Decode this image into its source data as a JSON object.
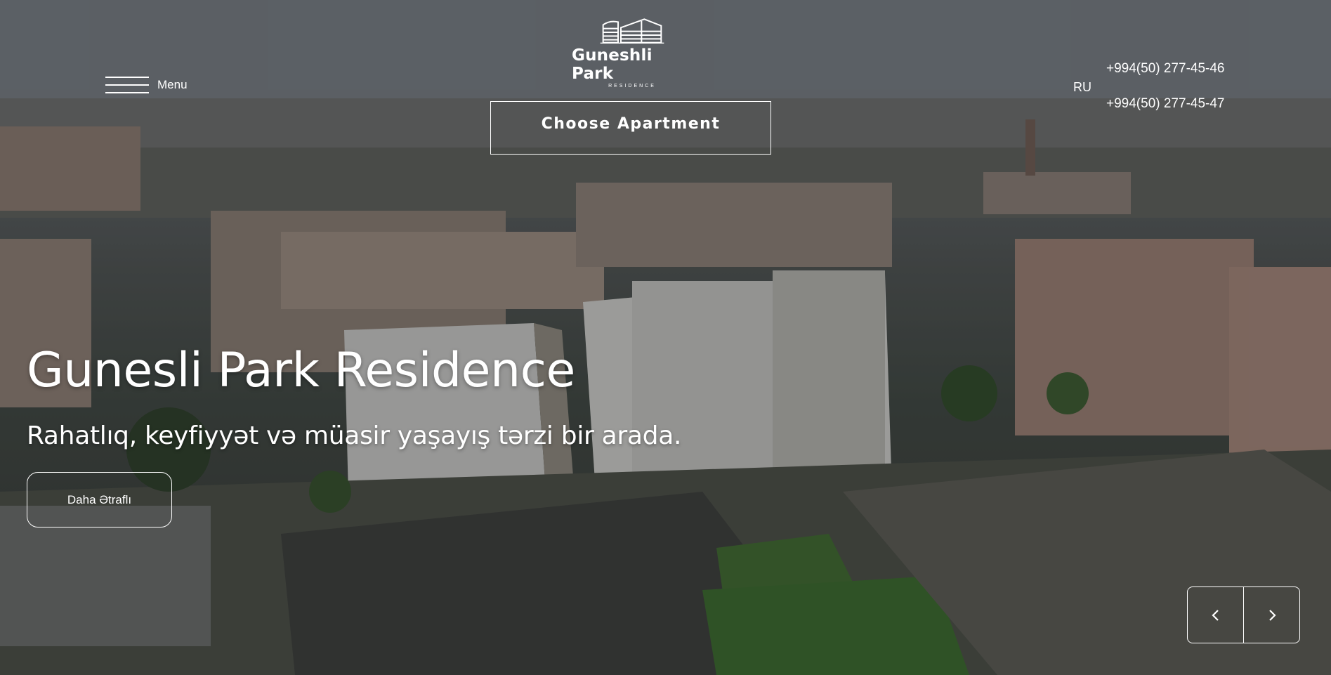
{
  "header": {
    "menu_label": "Menu",
    "logo": {
      "name": "Guneshli Park",
      "tagline": "RESIDENCE"
    },
    "choose_apartment_label": "Choose Apartment",
    "language": "RU",
    "phones": [
      "+994(50) 277-45-46",
      "+994(50) 277-45-47"
    ]
  },
  "hero": {
    "title": "Gunesli Park Residence",
    "subtitle": "Rahatlıq, keyfiyyət və müasir yaşayış tərzi bir arada.",
    "more_label": "Daha Ətraflı"
  },
  "slider": {
    "prev_icon": "chevron-left-icon",
    "next_icon": "chevron-right-icon"
  },
  "colors": {
    "text": "#ffffff",
    "overlay": "#1a1c1e"
  }
}
